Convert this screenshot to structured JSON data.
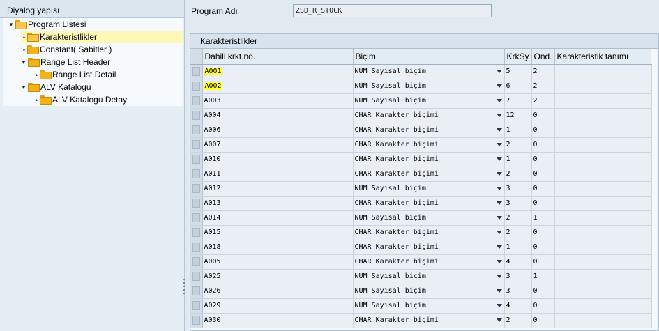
{
  "left_panel": {
    "title": "Diyalog yapısı",
    "tree": [
      {
        "label": "Program Listesi",
        "expanded": true,
        "level": 0
      },
      {
        "label": "Karakteristlikler",
        "level": 1,
        "selected": true
      },
      {
        "label": "Constant( Sabitler )",
        "level": 1
      },
      {
        "label": "Range List Header",
        "expanded": true,
        "level": 1
      },
      {
        "label": "Range List Detail",
        "level": 2
      },
      {
        "label": "ALV Katalogu",
        "expanded": true,
        "level": 1
      },
      {
        "label": "ALV Katalogu Detay",
        "level": 2
      }
    ]
  },
  "header": {
    "program_label": "Program Adı",
    "program_value": "ZSD_R_STOCK"
  },
  "grid": {
    "title": "Karakteristlikler",
    "columns": [
      "Dahili krkt.no.",
      "Biçim",
      "KrkSy",
      "Ond.",
      "Karakteristik tanımı"
    ],
    "rows": [
      {
        "code": "A001",
        "format": "NUM Sayısal biçim",
        "krksy": "5",
        "ond": "2",
        "highlight": true
      },
      {
        "code": "A002",
        "format": "NUM Sayısal biçim",
        "krksy": "6",
        "ond": "2",
        "highlight": true
      },
      {
        "code": "A003",
        "format": "NUM Sayısal biçim",
        "krksy": "7",
        "ond": "2"
      },
      {
        "code": "A004",
        "format": "CHAR Karakter biçimi",
        "krksy": "12",
        "ond": "0"
      },
      {
        "code": "A006",
        "format": "CHAR Karakter biçimi",
        "krksy": "1",
        "ond": "0"
      },
      {
        "code": "A007",
        "format": "CHAR Karakter biçimi",
        "krksy": "2",
        "ond": "0"
      },
      {
        "code": "A010",
        "format": "CHAR Karakter biçimi",
        "krksy": "1",
        "ond": "0"
      },
      {
        "code": "A011",
        "format": "CHAR Karakter biçimi",
        "krksy": "2",
        "ond": "0"
      },
      {
        "code": "A012",
        "format": "NUM Sayısal biçim",
        "krksy": "3",
        "ond": "0"
      },
      {
        "code": "A013",
        "format": "CHAR Karakter biçimi",
        "krksy": "3",
        "ond": "0"
      },
      {
        "code": "A014",
        "format": "NUM Sayısal biçim",
        "krksy": "2",
        "ond": "1"
      },
      {
        "code": "A015",
        "format": "CHAR Karakter biçimi",
        "krksy": "2",
        "ond": "0"
      },
      {
        "code": "A018",
        "format": "CHAR Karakter biçimi",
        "krksy": "1",
        "ond": "0"
      },
      {
        "code": "A005",
        "format": "CHAR Karakter biçimi",
        "krksy": "4",
        "ond": "0"
      },
      {
        "code": "A025",
        "format": "NUM Sayısal biçim",
        "krksy": "3",
        "ond": "1"
      },
      {
        "code": "A026",
        "format": "NUM Sayısal biçim",
        "krksy": "3",
        "ond": "0"
      },
      {
        "code": "A029",
        "format": "NUM Sayısal biçim",
        "krksy": "4",
        "ond": "0"
      },
      {
        "code": "A030",
        "format": "CHAR Karakter biçimi",
        "krksy": "2",
        "ond": "0"
      }
    ]
  },
  "colors": {
    "highlight": "#ffff33",
    "folder": "#f2b318",
    "selected_node": "#fdf7b8"
  }
}
